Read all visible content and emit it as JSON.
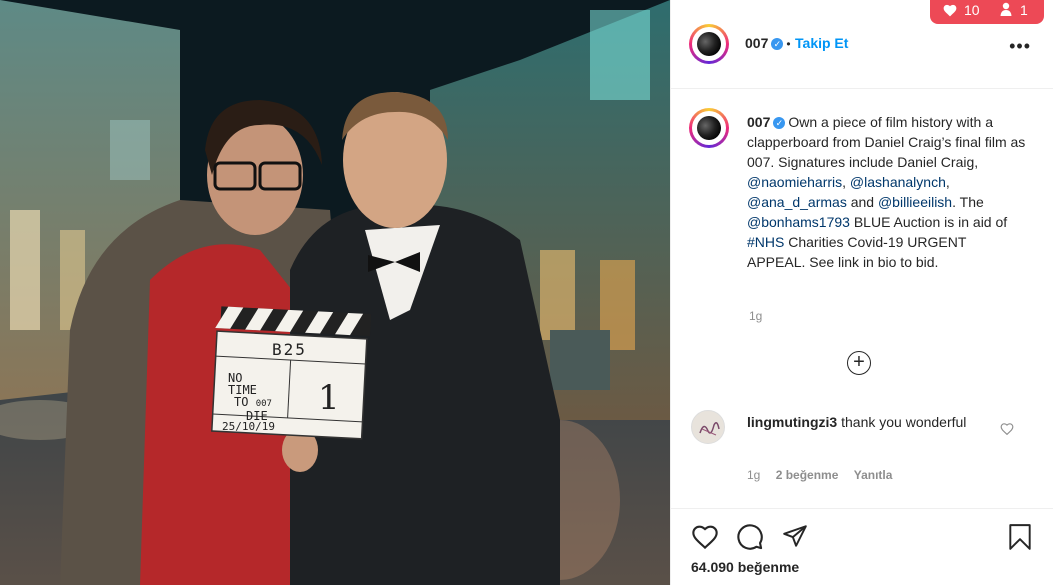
{
  "post": {
    "photo": {
      "clapper_scene": "B25",
      "clapper_title_line1": "NO",
      "clapper_title_line2": "TIME",
      "clapper_title_line3": "TO",
      "clapper_title_line4": "DIE",
      "clapper_note": "007",
      "clapper_take": "1",
      "clapper_date": "25/10/19"
    },
    "header": {
      "username": "007",
      "separator": "•",
      "follow_label": "Takip Et",
      "more_label": "•••"
    },
    "caption": {
      "username": "007",
      "text_1": "Own a piece of film history with a clapperboard from Daniel Craig’s final film as 007. Signatures include Daniel Craig, ",
      "mention_1": "@naomieharris",
      "sep_1": ", ",
      "mention_2": "@lashanalynch",
      "sep_2": ", ",
      "mention_3": "@ana_d_armas",
      "sep_3": " and ",
      "mention_4": "@billieeilish",
      "text_2": ". The ",
      "mention_5": "@bonhams1793",
      "text_3": " BLUE Auction is in aid of ",
      "hashtag": "#NHS",
      "text_4": " Charities Covid-19 URGENT APPEAL. See link in bio to bid.",
      "time": "1g"
    },
    "comment": {
      "username": "lingmutingzi3",
      "text": "thank you wonderful",
      "time": "1g",
      "likes": "2 beğenme",
      "reply": "Yanıtla"
    },
    "likes_count": "64.090 beğenme",
    "notification": {
      "likes": "10",
      "follows": "1"
    },
    "icons": {
      "like": "heart-icon",
      "comment": "comment-icon",
      "share": "paper-plane-icon",
      "save": "bookmark-icon",
      "load_more": "plus-circle-icon"
    }
  }
}
